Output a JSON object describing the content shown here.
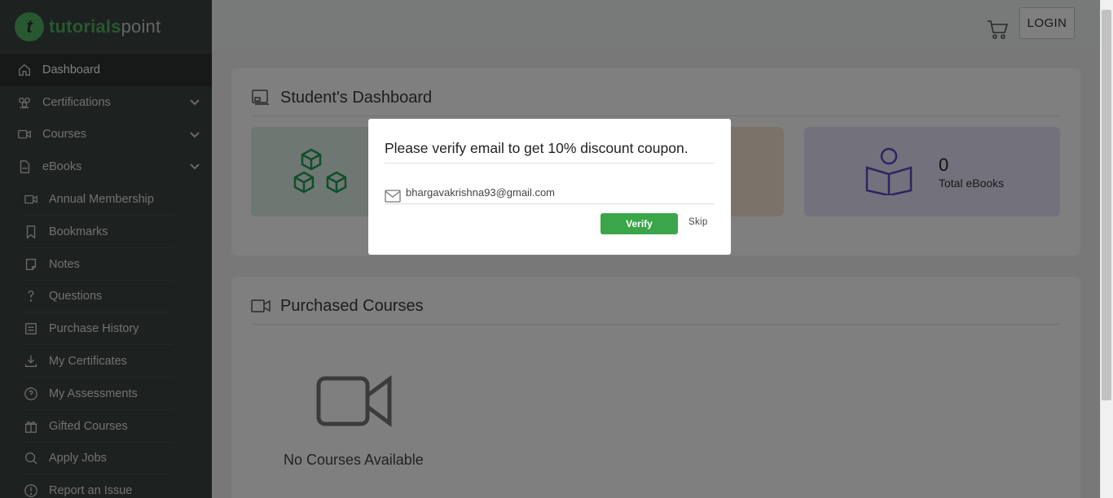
{
  "brand": {
    "logo_letter": "t",
    "name_part1": "tutorials",
    "name_part2": "point"
  },
  "sidebar": {
    "items": [
      {
        "label": "Dashboard"
      },
      {
        "label": "Certifications"
      },
      {
        "label": "Courses"
      },
      {
        "label": "eBooks"
      },
      {
        "label": "Annual Membership"
      },
      {
        "label": "Bookmarks"
      },
      {
        "label": "Notes"
      },
      {
        "label": "Questions"
      },
      {
        "label": "Purchase History"
      },
      {
        "label": "My Certificates"
      },
      {
        "label": "My Assessments"
      },
      {
        "label": "Gifted Courses"
      },
      {
        "label": "Apply Jobs"
      },
      {
        "label": "Report an Issue"
      }
    ]
  },
  "header": {
    "login_label": "LOGIN"
  },
  "dashboard": {
    "title": "Student's Dashboard",
    "ebooks_count": "0",
    "ebooks_label": "Total eBooks"
  },
  "purchased": {
    "title": "Purchased Courses",
    "empty_text": "No Courses Available"
  },
  "modal": {
    "title": "Please verify email to get 10% discount coupon.",
    "email_value": "bhargavakrishna93@gmail.com",
    "verify_label": "Verify",
    "skip_label": "Skip"
  },
  "colors": {
    "sidebar_bg": "#3b423e",
    "brand_green": "#4fb05f",
    "verify_green": "#3aa549",
    "stat_purple": "#5b48c6",
    "stat_green": "#1f9d55"
  }
}
